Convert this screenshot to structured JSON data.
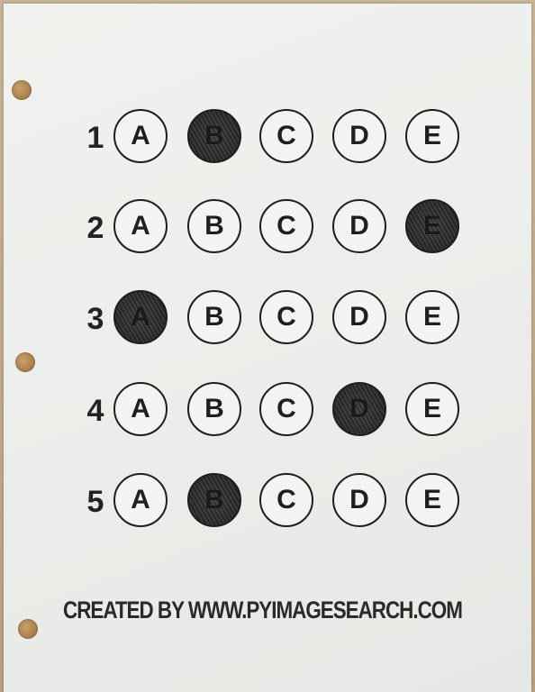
{
  "sheet": {
    "questions": [
      {
        "number": "1",
        "options": [
          "A",
          "B",
          "C",
          "D",
          "E"
        ],
        "marked": "B"
      },
      {
        "number": "2",
        "options": [
          "A",
          "B",
          "C",
          "D",
          "E"
        ],
        "marked": "E"
      },
      {
        "number": "3",
        "options": [
          "A",
          "B",
          "C",
          "D",
          "E"
        ],
        "marked": "A"
      },
      {
        "number": "4",
        "options": [
          "A",
          "B",
          "C",
          "D",
          "E"
        ],
        "marked": "D"
      },
      {
        "number": "5",
        "options": [
          "A",
          "B",
          "C",
          "D",
          "E"
        ],
        "marked": "B"
      }
    ],
    "credit": "CREATED BY WWW.PYIMAGESEARCH.COM"
  },
  "colors": {
    "ink": "#1e1e1e",
    "paper": "#eceeeb",
    "fill": "#2f2f2f",
    "hole": "#a67a45"
  }
}
